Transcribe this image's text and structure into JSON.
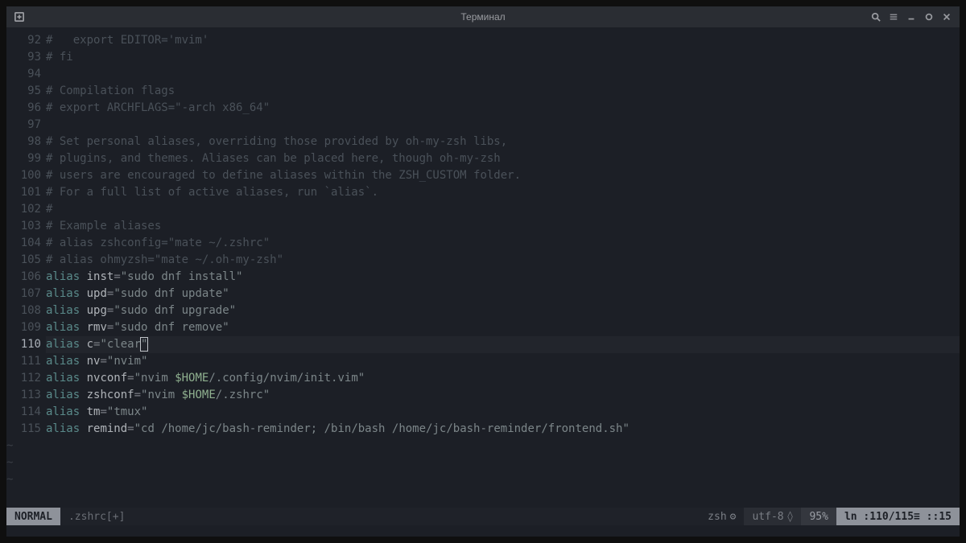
{
  "window": {
    "title": "Терминал"
  },
  "lines": [
    {
      "num": 92,
      "parts": [
        {
          "cls": "c-comment",
          "t": "#   export EDITOR='mvim'"
        }
      ]
    },
    {
      "num": 93,
      "parts": [
        {
          "cls": "c-comment",
          "t": "# fi"
        }
      ]
    },
    {
      "num": 94,
      "parts": []
    },
    {
      "num": 95,
      "parts": [
        {
          "cls": "c-comment",
          "t": "# Compilation flags"
        }
      ]
    },
    {
      "num": 96,
      "parts": [
        {
          "cls": "c-comment",
          "t": "# export ARCHFLAGS=\"-arch x86_64\""
        }
      ]
    },
    {
      "num": 97,
      "parts": []
    },
    {
      "num": 98,
      "parts": [
        {
          "cls": "c-comment",
          "t": "# Set personal aliases, overriding those provided by oh-my-zsh libs,"
        }
      ]
    },
    {
      "num": 99,
      "parts": [
        {
          "cls": "c-comment",
          "t": "# plugins, and themes. Aliases can be placed here, though oh-my-zsh"
        }
      ]
    },
    {
      "num": 100,
      "parts": [
        {
          "cls": "c-comment",
          "t": "# users are encouraged to define aliases within the ZSH_CUSTOM folder."
        }
      ]
    },
    {
      "num": 101,
      "parts": [
        {
          "cls": "c-comment",
          "t": "# For a full list of active aliases, run `alias`."
        }
      ]
    },
    {
      "num": 102,
      "parts": [
        {
          "cls": "c-comment",
          "t": "#"
        }
      ]
    },
    {
      "num": 103,
      "parts": [
        {
          "cls": "c-comment",
          "t": "# Example aliases"
        }
      ]
    },
    {
      "num": 104,
      "parts": [
        {
          "cls": "c-comment",
          "t": "# alias zshconfig=\"mate ~/.zshrc\""
        }
      ]
    },
    {
      "num": 105,
      "parts": [
        {
          "cls": "c-comment",
          "t": "# alias ohmyzsh=\"mate ~/.oh-my-zsh\""
        }
      ]
    },
    {
      "num": 106,
      "parts": [
        {
          "cls": "c-keyword",
          "t": "alias"
        },
        {
          "cls": "",
          "t": " "
        },
        {
          "cls": "c-ident",
          "t": "inst"
        },
        {
          "cls": "c-punct",
          "t": "="
        },
        {
          "cls": "c-string",
          "t": "\"sudo dnf install\""
        }
      ]
    },
    {
      "num": 107,
      "parts": [
        {
          "cls": "c-keyword",
          "t": "alias"
        },
        {
          "cls": "",
          "t": " "
        },
        {
          "cls": "c-ident",
          "t": "upd"
        },
        {
          "cls": "c-punct",
          "t": "="
        },
        {
          "cls": "c-string",
          "t": "\"sudo dnf update\""
        }
      ]
    },
    {
      "num": 108,
      "parts": [
        {
          "cls": "c-keyword",
          "t": "alias"
        },
        {
          "cls": "",
          "t": " "
        },
        {
          "cls": "c-ident",
          "t": "upg"
        },
        {
          "cls": "c-punct",
          "t": "="
        },
        {
          "cls": "c-string",
          "t": "\"sudo dnf upgrade\""
        }
      ]
    },
    {
      "num": 109,
      "parts": [
        {
          "cls": "c-keyword",
          "t": "alias"
        },
        {
          "cls": "",
          "t": " "
        },
        {
          "cls": "c-ident",
          "t": "rmv"
        },
        {
          "cls": "c-punct",
          "t": "="
        },
        {
          "cls": "c-string",
          "t": "\"sudo dnf remove\""
        }
      ]
    },
    {
      "num": 110,
      "active": true,
      "parts": [
        {
          "cls": "c-keyword",
          "t": "alias"
        },
        {
          "cls": "",
          "t": " "
        },
        {
          "cls": "c-ident",
          "t": "c"
        },
        {
          "cls": "c-punct",
          "t": "="
        },
        {
          "cls": "c-string",
          "t": "\"clear"
        },
        {
          "cls": "c-string cursor-box",
          "t": "\""
        }
      ]
    },
    {
      "num": 111,
      "parts": [
        {
          "cls": "c-keyword",
          "t": "alias"
        },
        {
          "cls": "",
          "t": " "
        },
        {
          "cls": "c-ident",
          "t": "nv"
        },
        {
          "cls": "c-punct",
          "t": "="
        },
        {
          "cls": "c-string",
          "t": "\"nvim\""
        }
      ]
    },
    {
      "num": 112,
      "parts": [
        {
          "cls": "c-keyword",
          "t": "alias"
        },
        {
          "cls": "",
          "t": " "
        },
        {
          "cls": "c-ident",
          "t": "nvconf"
        },
        {
          "cls": "c-punct",
          "t": "="
        },
        {
          "cls": "c-string",
          "t": "\"nvim "
        },
        {
          "cls": "c-var",
          "t": "$HOME"
        },
        {
          "cls": "c-string",
          "t": "/.config/nvim/init.vim\""
        }
      ]
    },
    {
      "num": 113,
      "parts": [
        {
          "cls": "c-keyword",
          "t": "alias"
        },
        {
          "cls": "",
          "t": " "
        },
        {
          "cls": "c-ident",
          "t": "zshconf"
        },
        {
          "cls": "c-punct",
          "t": "="
        },
        {
          "cls": "c-string",
          "t": "\"nvim "
        },
        {
          "cls": "c-var",
          "t": "$HOME"
        },
        {
          "cls": "c-string",
          "t": "/.zshrc\""
        }
      ]
    },
    {
      "num": 114,
      "parts": [
        {
          "cls": "c-keyword",
          "t": "alias"
        },
        {
          "cls": "",
          "t": " "
        },
        {
          "cls": "c-ident",
          "t": "tm"
        },
        {
          "cls": "c-punct",
          "t": "="
        },
        {
          "cls": "c-string",
          "t": "\"tmux\""
        }
      ]
    },
    {
      "num": 115,
      "parts": [
        {
          "cls": "c-keyword",
          "t": "alias"
        },
        {
          "cls": "",
          "t": " "
        },
        {
          "cls": "c-ident",
          "t": "remind"
        },
        {
          "cls": "c-punct",
          "t": "="
        },
        {
          "cls": "c-string",
          "t": "\"cd /home/jc/bash-reminder; /bin/bash /home/jc/bash-reminder/frontend.sh\""
        }
      ]
    }
  ],
  "eof_tildes": 3,
  "status": {
    "mode": "NORMAL",
    "filename": ".zshrc[+]",
    "filetype": "zsh",
    "encoding": "utf-8",
    "percent": "95%",
    "lineinfo": "ln :110/115≡ ::15"
  }
}
